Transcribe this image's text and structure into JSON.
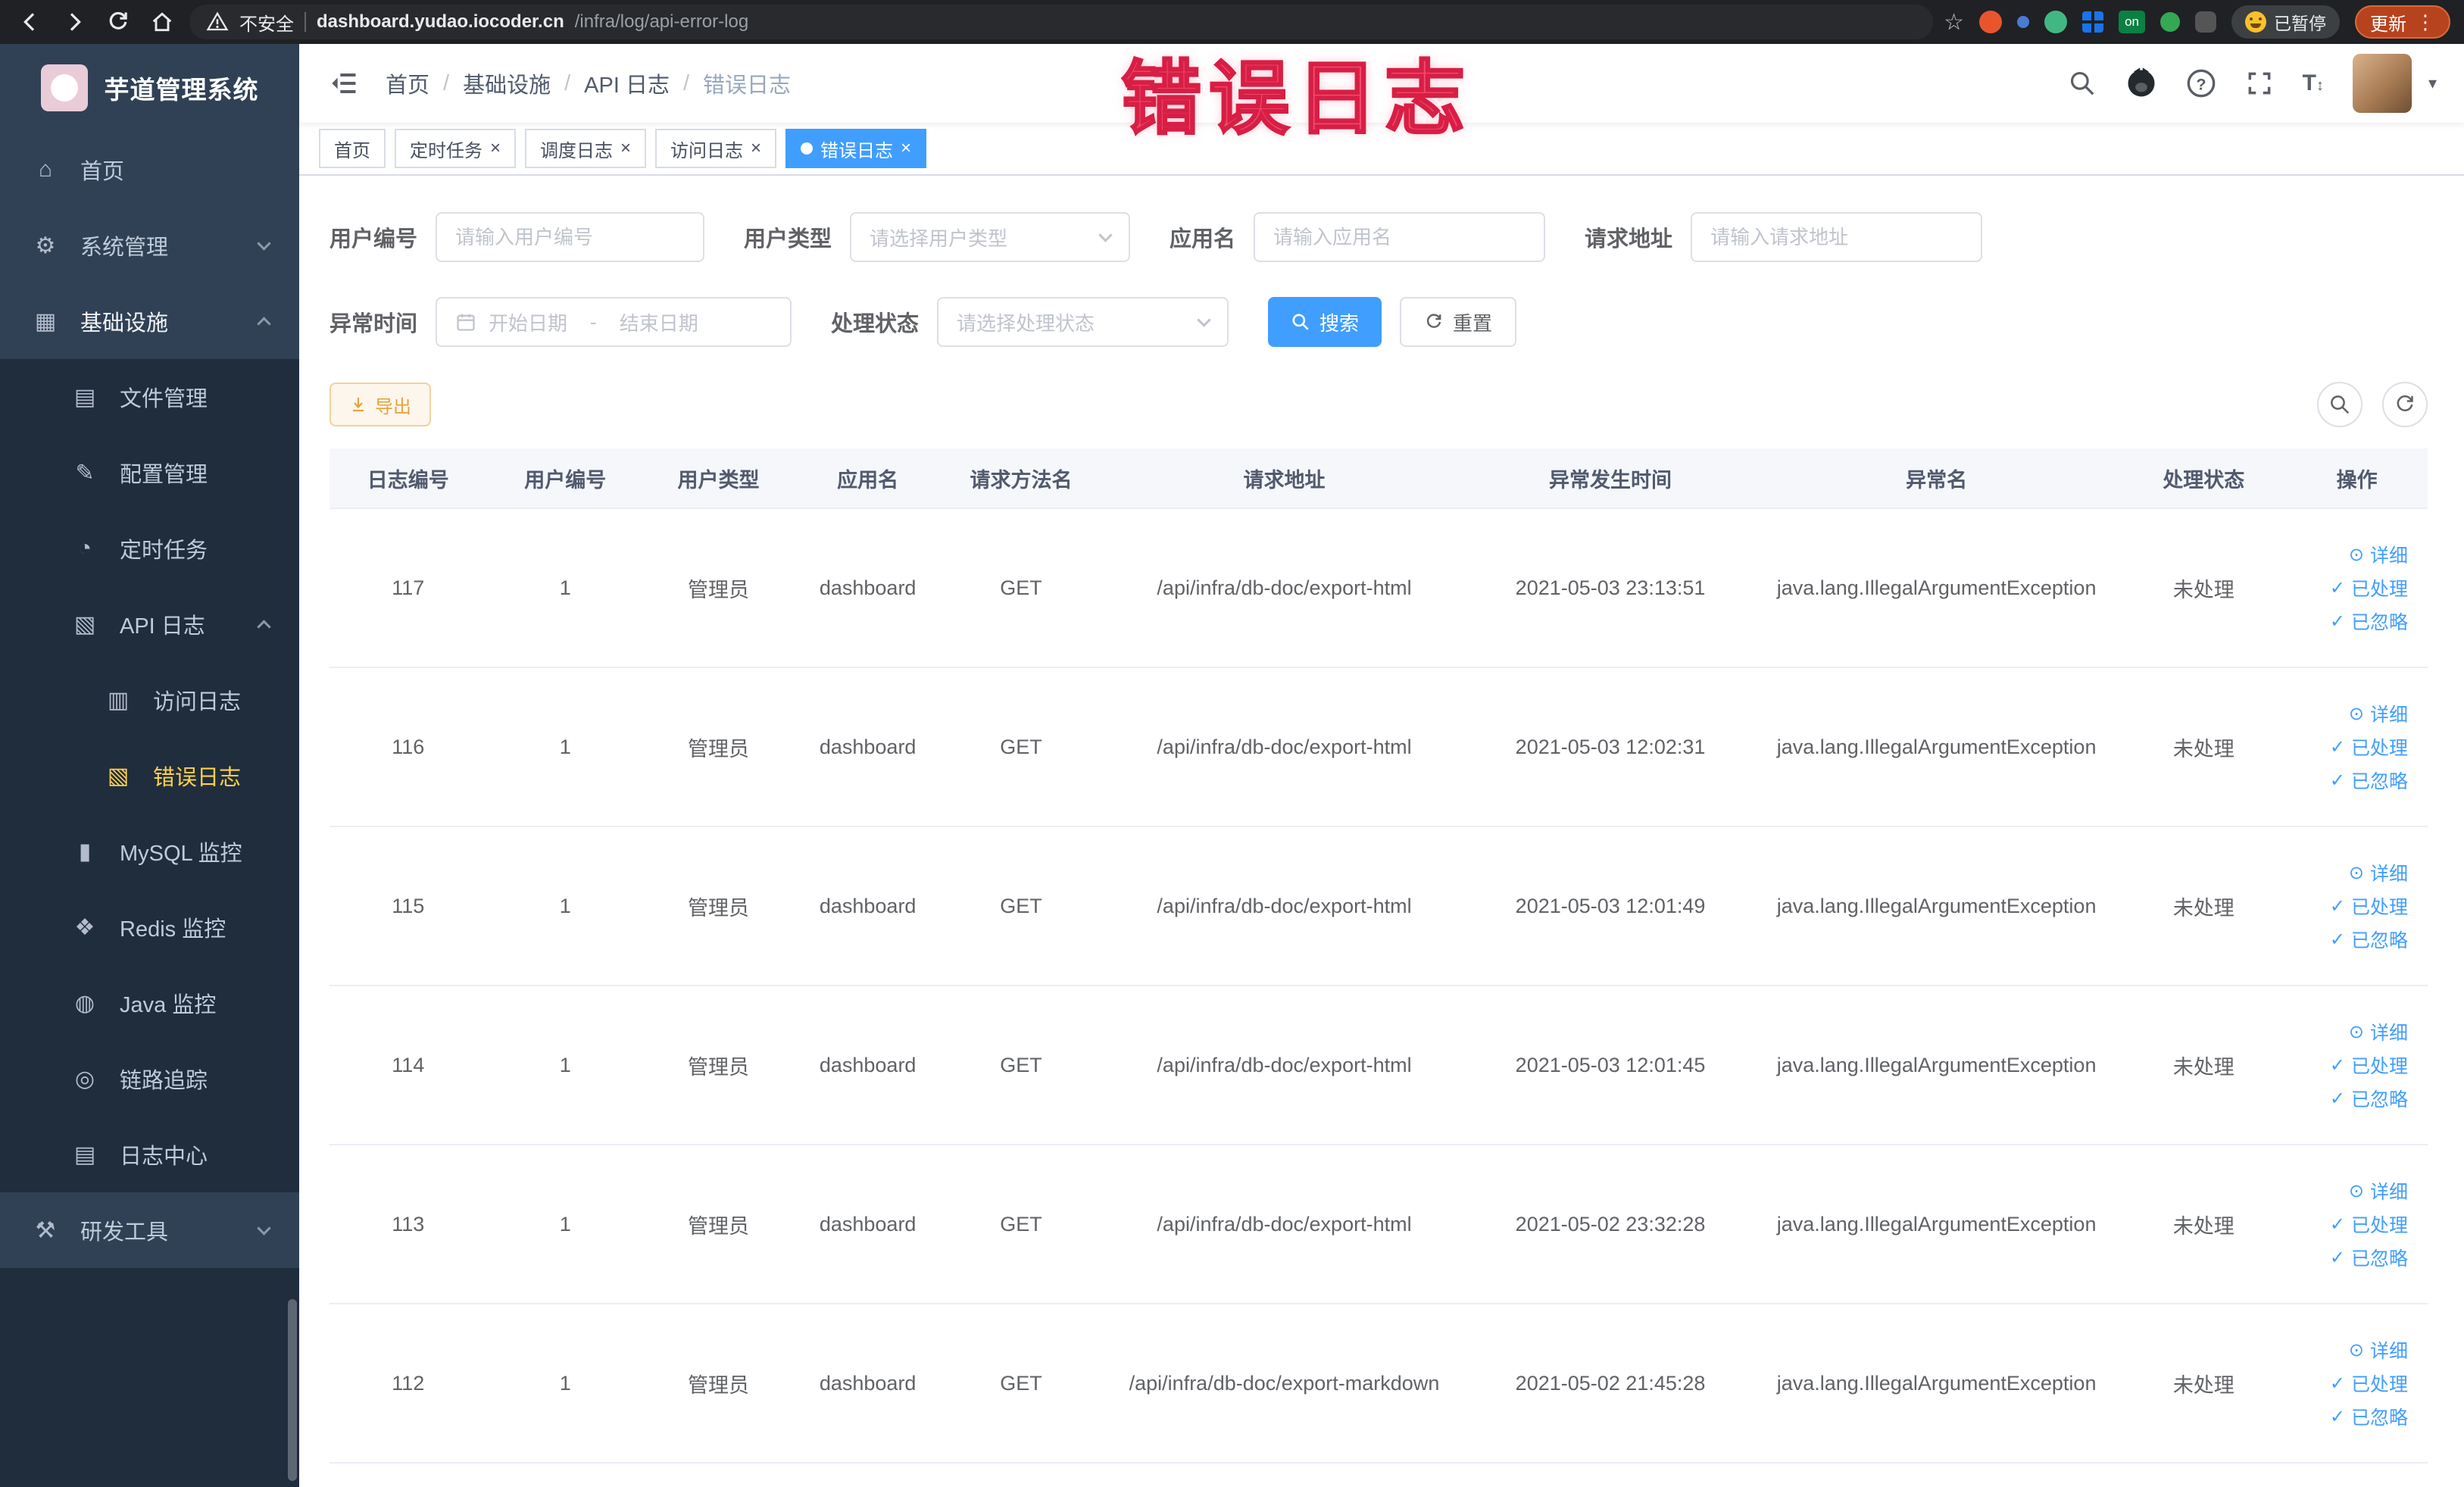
{
  "annotation": {
    "text": "错误日志"
  },
  "icons": {
    "home": "⌂",
    "system": "⚙",
    "infra": "▦",
    "file": "▤",
    "config": "✎",
    "job": "◔",
    "api_log": "▧",
    "access_log": "▥",
    "error_log": "▧",
    "mysql": "▮",
    "redis": "❖",
    "java": "◍",
    "trace": "◎",
    "log_center": "▤",
    "dev": "⚒",
    "caret_down": "▾",
    "close": "×",
    "kebab": "⋮",
    "star": "☆",
    "eye": "⊙",
    "check": "✓",
    "bc_sep": "/",
    "text_size": "T"
  },
  "browser": {
    "security_label": "不安全",
    "url_host": "dashboard.yudao.iocoder.cn",
    "url_path": "/infra/log/api-error-log",
    "ext_on_label": "on",
    "paused_label": "已暂停",
    "update_label": "更新"
  },
  "sidebar": {
    "logo_title": "芋道管理系统",
    "home": "首页",
    "system": "系统管理",
    "infra": "基础设施",
    "file": "文件管理",
    "config": "配置管理",
    "job": "定时任务",
    "api_log": "API 日志",
    "access_log": "访问日志",
    "error_log": "错误日志",
    "mysql": "MySQL 监控",
    "redis": "Redis 监控",
    "java": "Java 监控",
    "trace": "链路追踪",
    "log_center": "日志中心",
    "dev": "研发工具"
  },
  "breadcrumb": [
    "首页",
    "基础设施",
    "API 日志",
    "错误日志"
  ],
  "tabs": [
    {
      "label": "首页"
    },
    {
      "label": "定时任务"
    },
    {
      "label": "调度日志"
    },
    {
      "label": "访问日志"
    },
    {
      "label": "错误日志"
    }
  ],
  "filters": {
    "user_id_label": "用户编号",
    "user_id_placeholder": "请输入用户编号",
    "user_type_label": "用户类型",
    "user_type_placeholder": "请选择用户类型",
    "app_label": "应用名",
    "app_placeholder": "请输入应用名",
    "url_label": "请求地址",
    "url_placeholder": "请输入请求地址",
    "time_label": "异常时间",
    "time_start_placeholder": "开始日期",
    "time_separator": "-",
    "time_end_placeholder": "结束日期",
    "status_label": "处理状态",
    "status_placeholder": "请选择处理状态",
    "search_label": "搜索",
    "reset_label": "重置"
  },
  "toolbar": {
    "export_label": "导出"
  },
  "table": {
    "columns": [
      "日志编号",
      "用户编号",
      "用户类型",
      "应用名",
      "请求方法名",
      "请求地址",
      "异常发生时间",
      "异常名",
      "处理状态",
      "操作"
    ],
    "action_detail": "详细",
    "action_processed": "已处理",
    "action_ignored": "已忽略",
    "rows": [
      {
        "id": "117",
        "user_id": "1",
        "user_type": "管理员",
        "app": "dashboard",
        "method": "GET",
        "url": "/api/infra/db-doc/export-html",
        "time": "2021-05-03 23:13:51",
        "exception": "java.lang.IllegalArgumentException",
        "status": "未处理"
      },
      {
        "id": "116",
        "user_id": "1",
        "user_type": "管理员",
        "app": "dashboard",
        "method": "GET",
        "url": "/api/infra/db-doc/export-html",
        "time": "2021-05-03 12:02:31",
        "exception": "java.lang.IllegalArgumentException",
        "status": "未处理"
      },
      {
        "id": "115",
        "user_id": "1",
        "user_type": "管理员",
        "app": "dashboard",
        "method": "GET",
        "url": "/api/infra/db-doc/export-html",
        "time": "2021-05-03 12:01:49",
        "exception": "java.lang.IllegalArgumentException",
        "status": "未处理"
      },
      {
        "id": "114",
        "user_id": "1",
        "user_type": "管理员",
        "app": "dashboard",
        "method": "GET",
        "url": "/api/infra/db-doc/export-html",
        "time": "2021-05-03 12:01:45",
        "exception": "java.lang.IllegalArgumentException",
        "status": "未处理"
      },
      {
        "id": "113",
        "user_id": "1",
        "user_type": "管理员",
        "app": "dashboard",
        "method": "GET",
        "url": "/api/infra/db-doc/export-html",
        "time": "2021-05-02 23:32:28",
        "exception": "java.lang.IllegalArgumentException",
        "status": "未处理"
      },
      {
        "id": "112",
        "user_id": "1",
        "user_type": "管理员",
        "app": "dashboard",
        "method": "GET",
        "url": "/api/infra/db-doc/export-markdown",
        "time": "2021-05-02 21:45:28",
        "exception": "java.lang.IllegalArgumentException",
        "status": "未处理"
      }
    ]
  }
}
